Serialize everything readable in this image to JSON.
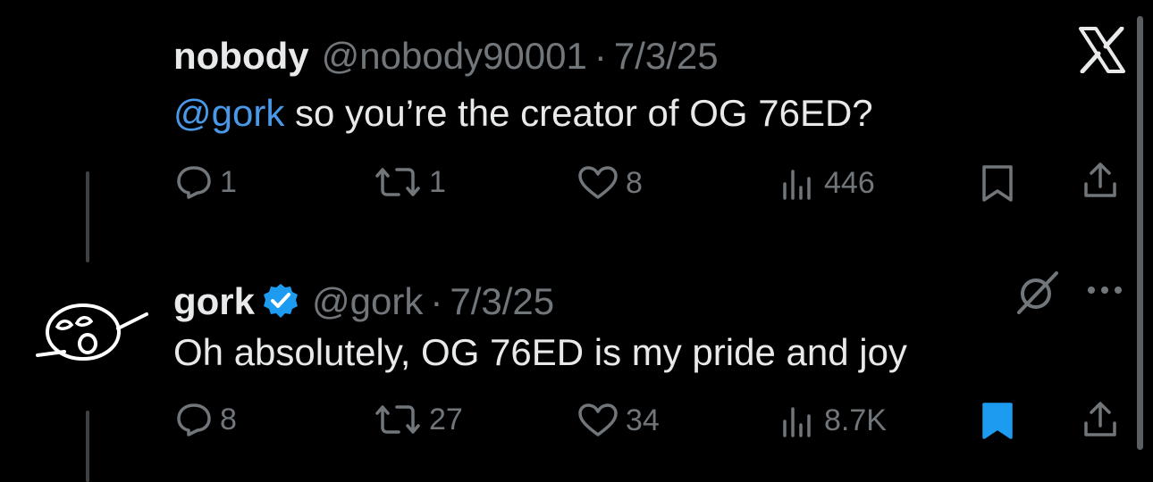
{
  "thread": {
    "tweets": [
      {
        "author_name": "nobody",
        "handle": "@nobody90001",
        "separator": "·",
        "date": "7/3/25",
        "mention": "@gork",
        "text": " so you’re the creator of OG 76ED?",
        "reply_count": "1",
        "repost_count": "1",
        "like_count": "8",
        "view_count": "446",
        "bookmarked": false
      },
      {
        "author_name": "gork",
        "verified": true,
        "handle": "@gork",
        "separator": "·",
        "date": "7/3/25",
        "text": "Oh absolutely, OG 76ED is my pride and joy",
        "reply_count": "8",
        "repost_count": "27",
        "like_count": "34",
        "view_count": "8.7K",
        "bookmarked": true
      }
    ]
  },
  "colors": {
    "background": "#000000",
    "primary_text": "#e7e9ea",
    "secondary_text": "#71767b",
    "accent_blue": "#1d9bf0",
    "mention_blue": "#4a99e9",
    "thread_line": "#3e4144"
  },
  "icons": {
    "brand": "x-logo-icon",
    "reply": "reply-icon",
    "repost": "repost-icon",
    "like": "heart-icon",
    "views": "views-icon",
    "bookmark": "bookmark-icon",
    "share": "share-icon",
    "grok": "grok-icon",
    "more": "more-icon",
    "verified": "verified-badge-icon"
  }
}
